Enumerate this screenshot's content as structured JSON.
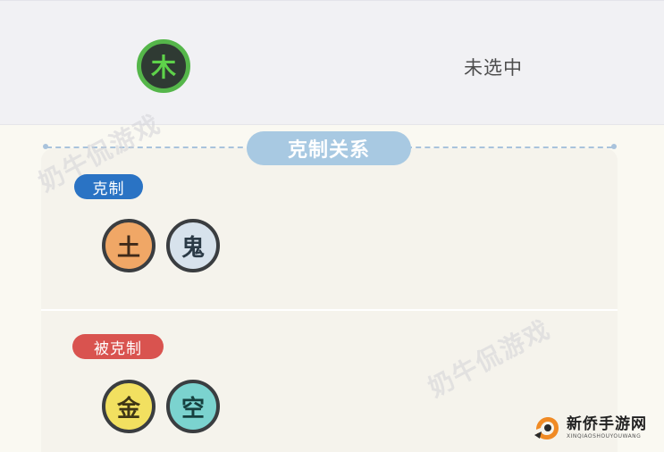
{
  "selected_element": {
    "glyph": "木",
    "status": "未选中"
  },
  "section": {
    "title": "克制关系"
  },
  "counter": {
    "label": "克制",
    "elements": [
      "土",
      "鬼"
    ]
  },
  "countered": {
    "label": "被克制",
    "elements": [
      "金",
      "空"
    ]
  },
  "watermarks": [
    "奶牛侃游戏",
    "奶牛侃游戏"
  ],
  "logo": {
    "title": "新侨手游网",
    "subtitle": "XINQIAOSHOUYOUWANG"
  },
  "colors": {
    "wood": "#55b64a",
    "earth": "#f0a766",
    "ghost": "#d7e2ec",
    "metal": "#f2e060",
    "void": "#7bd3cf",
    "counter_label": "#2a73c4",
    "countered_label": "#d9534f",
    "section_pill": "#a8c9e2"
  }
}
